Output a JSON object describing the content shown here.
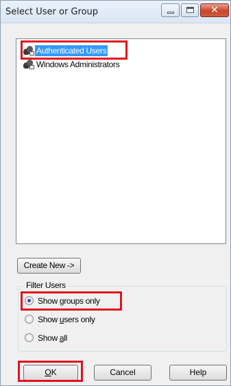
{
  "window": {
    "title": "Select User or Group",
    "controls": {
      "minimize": "minimize-icon",
      "maximize": "maximize-icon",
      "close": "close-icon",
      "close_glyph": "✕"
    }
  },
  "list": {
    "items": [
      {
        "label": "Authenticated Users",
        "icon": "user-group-icon",
        "selected": true
      },
      {
        "label": "Windows Administrators",
        "icon": "user-group-icon",
        "selected": false
      }
    ]
  },
  "create_new": {
    "label": "Create New ->"
  },
  "filter": {
    "title": "Filter Users",
    "options": [
      {
        "prefix": "Show ",
        "mnemonic": "g",
        "suffix": "roups only",
        "checked": true
      },
      {
        "prefix": "Show ",
        "mnemonic": "u",
        "suffix": "sers only",
        "checked": false
      },
      {
        "prefix": "Show ",
        "mnemonic": "a",
        "suffix": "ll",
        "checked": false
      }
    ]
  },
  "buttons": {
    "ok": {
      "mnemonic": "O",
      "rest": "K"
    },
    "cancel": "Cancel",
    "help": "Help"
  },
  "colors": {
    "selection": "#3399ff",
    "annotation": "#e0131e",
    "titlebar": "#dbe6f4",
    "close_button": "#c8462c"
  }
}
